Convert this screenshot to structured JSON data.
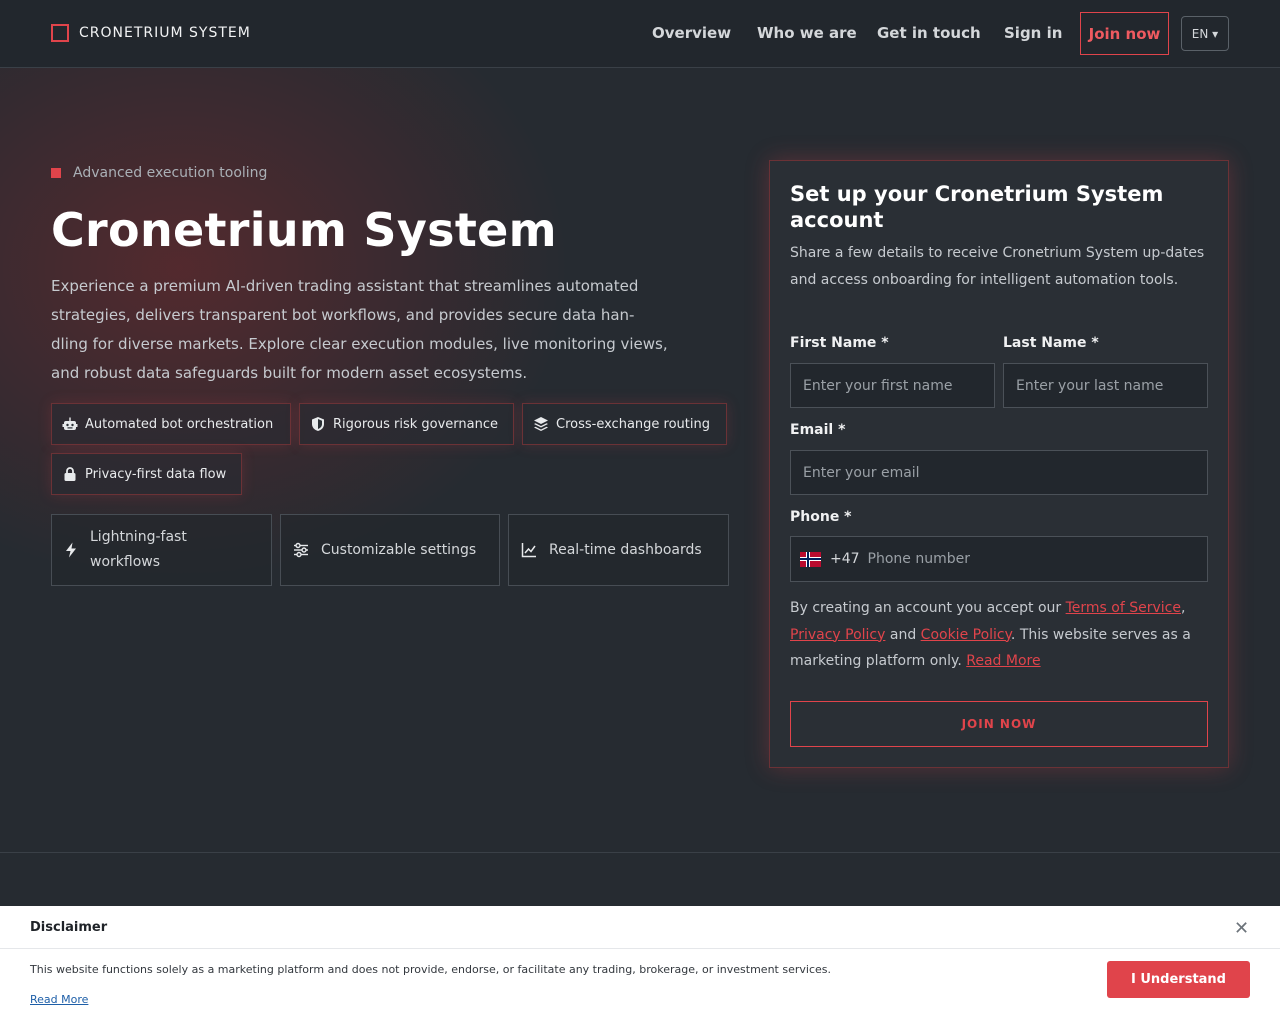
{
  "brand": {
    "name": "CRONETRIUM SYSTEM"
  },
  "nav": {
    "items": [
      "Overview",
      "Who we are",
      "Get in touch",
      "Sign in"
    ],
    "join_label": "Join now",
    "lang_label": "EN ▾"
  },
  "hero": {
    "tagline": "Advanced execution tooling",
    "title": "Cronetrium System",
    "description": "Experience a premium AI-driven trading assistant that streamlines automated strategies, delivers transparent bot workflows, and provides secure data han-dling for diverse markets. Explore clear execution modules, live monitoring views, and robust data safeguards built for modern asset ecosystems.",
    "pills": [
      {
        "label": "Automated bot orchestration",
        "icon": "robot-icon"
      },
      {
        "label": "Rigorous risk governance",
        "icon": "shield-icon"
      },
      {
        "label": "Cross-exchange routing",
        "icon": "layers-icon"
      },
      {
        "label": "Privacy-first data flow",
        "icon": "lock-icon"
      }
    ],
    "features": [
      {
        "label": "Lightning-fast workflows",
        "icon": "lightning-icon"
      },
      {
        "label": "Customizable settings",
        "icon": "sliders-icon"
      },
      {
        "label": "Real-time dashboards",
        "icon": "chart-line-icon"
      }
    ]
  },
  "form": {
    "title": "Set up your Cronetrium System account",
    "subtitle": "Share a few details to receive Cronetrium System up-dates and access onboarding for intelligent automation tools.",
    "first_name_label": "First Name *",
    "first_name_placeholder": "Enter your first name",
    "last_name_label": "Last Name *",
    "last_name_placeholder": "Enter your last name",
    "email_label": "Email *",
    "email_placeholder": "Enter your email",
    "phone_label": "Phone *",
    "phone_dial": "+47",
    "phone_placeholder": "Phone number",
    "consent": {
      "prefix": "By creating an account you accept our ",
      "terms": "Terms of Service",
      "comma": ",",
      "privacy": "Privacy Policy",
      "and": " and ",
      "cookie": "Cookie Policy",
      "suffix": ". This website serves as a marketing platform only. ",
      "read_more": "Read More"
    },
    "submit_label": "JOIN NOW"
  },
  "disclaimer": {
    "title": "Disclaimer",
    "close": "✕",
    "text": "This website functions solely as a marketing platform and does not provide, endorse, or facilitate any trading, brokerage, or investment services.",
    "read_more": "Read More",
    "button": "I Understand"
  },
  "colors": {
    "accent": "#e0444b",
    "background": "#262b31",
    "header": "#22272d"
  }
}
